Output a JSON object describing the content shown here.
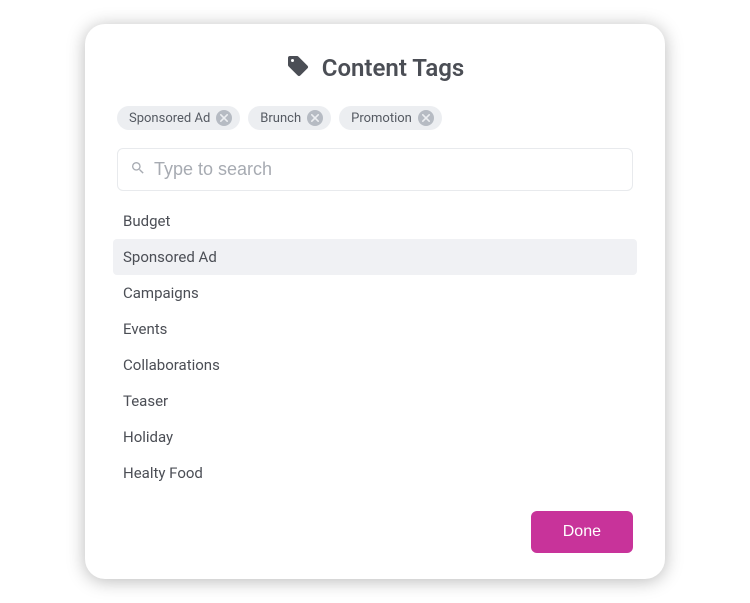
{
  "header": {
    "title": "Content Tags"
  },
  "selected_tags": [
    {
      "label": "Sponsored Ad"
    },
    {
      "label": "Brunch"
    },
    {
      "label": "Promotion"
    }
  ],
  "search": {
    "placeholder": "Type to search",
    "value": ""
  },
  "suggestions": [
    {
      "label": "Budget",
      "highlighted": false
    },
    {
      "label": "Sponsored Ad",
      "highlighted": true
    },
    {
      "label": "Campaigns",
      "highlighted": false
    },
    {
      "label": "Events",
      "highlighted": false
    },
    {
      "label": "Collaborations",
      "highlighted": false
    },
    {
      "label": "Teaser",
      "highlighted": false
    },
    {
      "label": "Holiday",
      "highlighted": false
    },
    {
      "label": "Healty Food",
      "highlighted": false
    }
  ],
  "footer": {
    "done_label": "Done"
  }
}
